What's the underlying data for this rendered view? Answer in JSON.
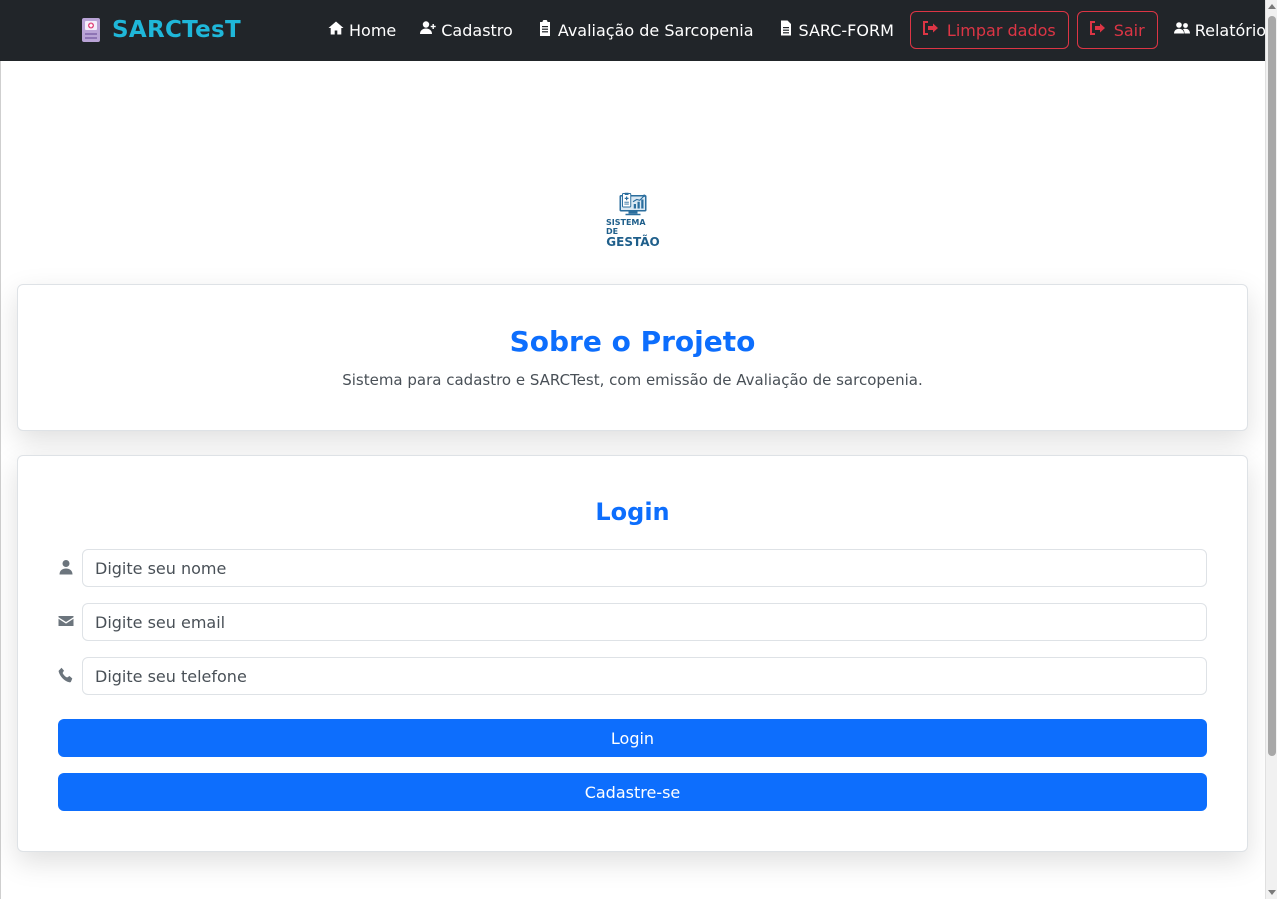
{
  "app": {
    "brand": "SARCTesT"
  },
  "nav": {
    "items": [
      {
        "label": "Home",
        "icon": "home-icon"
      },
      {
        "label": "Cadastro",
        "icon": "user-plus-icon"
      },
      {
        "label": "Avaliação de Sarcopenia",
        "icon": "clipboard-icon"
      },
      {
        "label": "SARC-FORM",
        "icon": "file-icon"
      }
    ],
    "clear_label": "Limpar dados",
    "logout_label": "Sair",
    "report_label": "Relatório"
  },
  "logo": {
    "line1": "SISTEMA DE",
    "line2": "GESTÃO"
  },
  "about": {
    "title": "Sobre o Projeto",
    "description": "Sistema para cadastro e SARCTest, com emissão de Avaliação de sarcopenia."
  },
  "login": {
    "title": "Login",
    "name_placeholder": "Digite seu nome",
    "email_placeholder": "Digite seu email",
    "phone_placeholder": "Digite seu telefone",
    "login_button": "Login",
    "register_button": "Cadastre-se"
  },
  "colors": {
    "navbar_bg": "#212529",
    "brand": "#1fb7d9",
    "primary": "#0d6efd",
    "danger": "#dc3545"
  }
}
